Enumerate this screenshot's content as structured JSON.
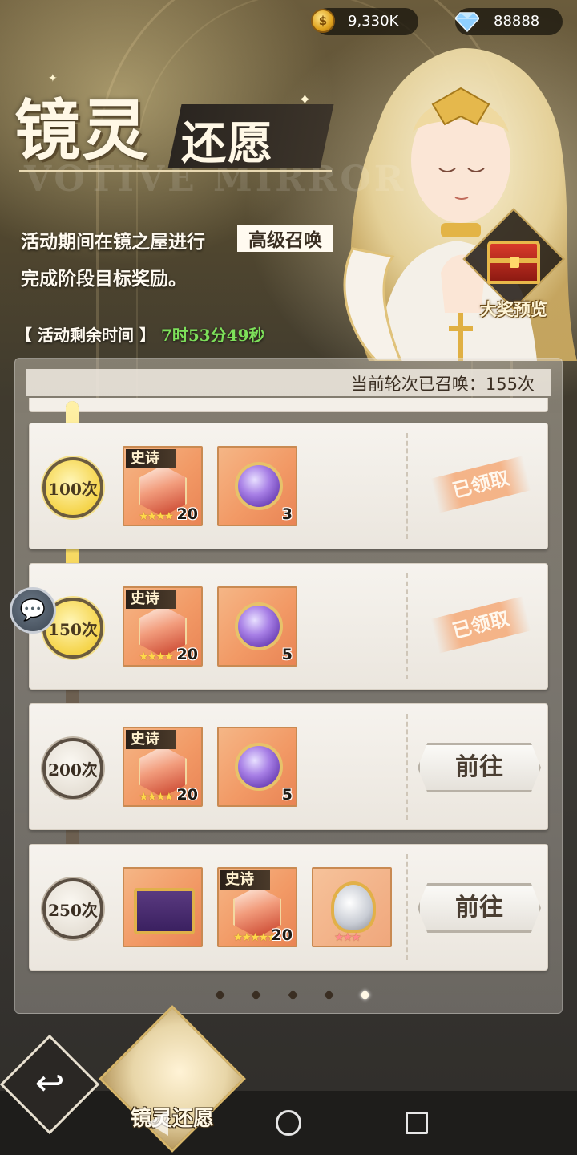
{
  "currency": {
    "gold_icon_label": "$",
    "gold_value": "9,330K",
    "gem_value": "88888"
  },
  "title": {
    "main": "镜灵",
    "sub": "还愿",
    "watermark": "VOTIVE MIRROR"
  },
  "description": {
    "line1": "活动期间在镜之屋进行",
    "highlight": "高级召唤",
    "line2": "完成阶段目标奖励。"
  },
  "timer": {
    "label": "【 活动剩余时间 】",
    "value": "7时53分49秒"
  },
  "grand_prize": {
    "label": "大奖预览"
  },
  "panel": {
    "summon_count_text": "当前轮次已召唤：155次"
  },
  "rows": [
    {
      "milestone": "100次",
      "items": [
        {
          "tag": "史诗",
          "qty": "20",
          "stars": "★★★★"
        },
        {
          "qty": "3"
        }
      ],
      "status": "已领取"
    },
    {
      "milestone": "150次",
      "items": [
        {
          "tag": "史诗",
          "qty": "20",
          "stars": "★★★★"
        },
        {
          "qty": "5"
        }
      ],
      "status": "已领取"
    },
    {
      "milestone": "200次",
      "items": [
        {
          "tag": "史诗",
          "qty": "20",
          "stars": "★★★★"
        },
        {
          "qty": "5"
        }
      ],
      "action": "前往"
    },
    {
      "milestone": "250次",
      "items": [
        {},
        {
          "tag": "史诗",
          "qty": "20",
          "stars": "★★★★★"
        },
        {
          "stars": "★★★"
        }
      ],
      "action": "前往"
    }
  ],
  "pagination": {
    "total": 5,
    "active": 5
  },
  "chat": {
    "icon": "💬"
  },
  "bottom": {
    "back_icon": "↩",
    "portrait_label": "镜灵还愿"
  }
}
